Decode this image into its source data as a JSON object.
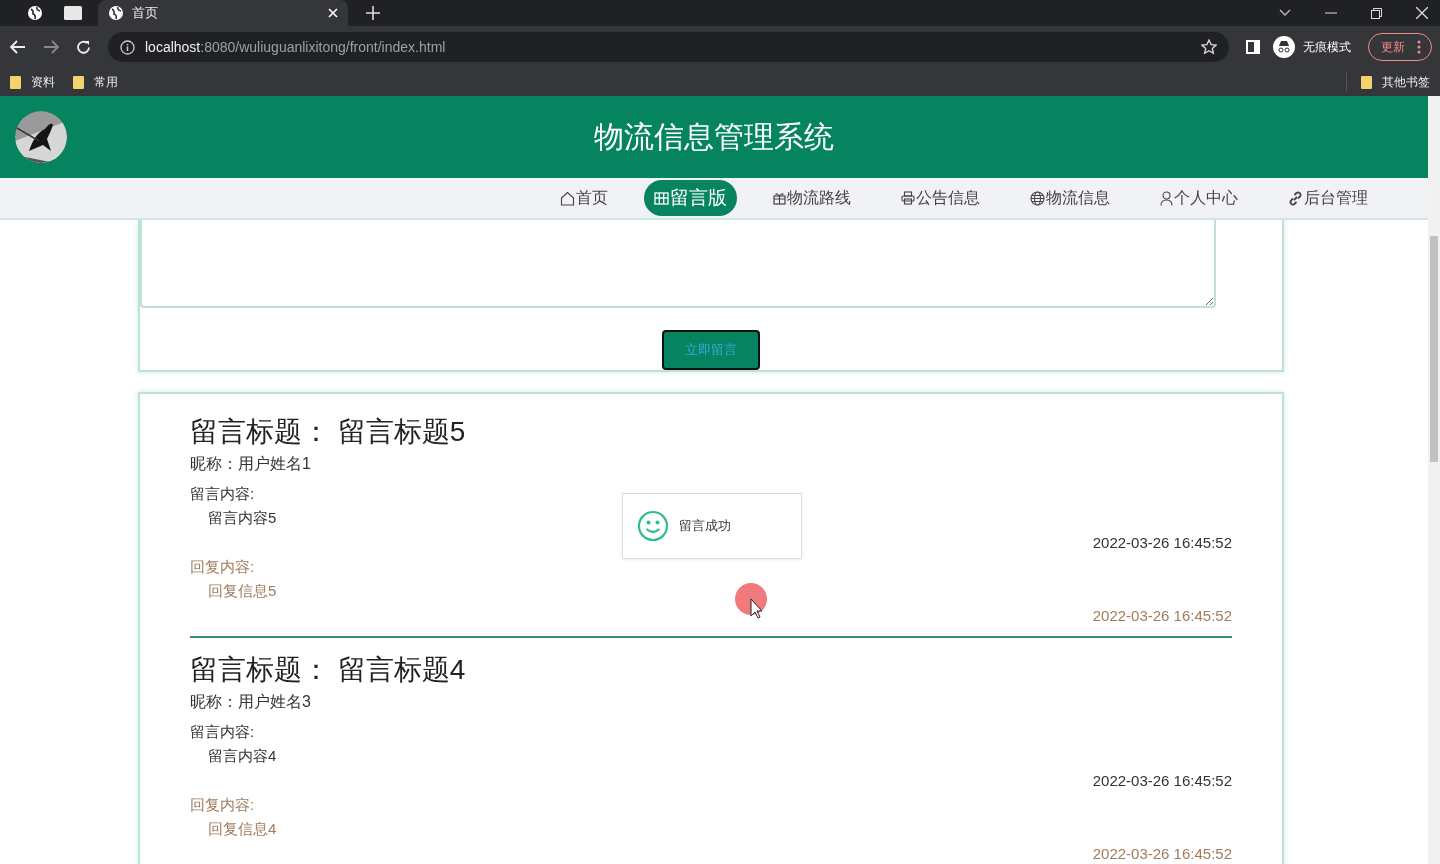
{
  "browser": {
    "tabs": [
      {
        "title": "首页",
        "selected": true
      }
    ],
    "address": {
      "host": "localhost",
      "path": ":8080/wuliuguanlixitong/front/index.html"
    },
    "profile": "无痕模式",
    "update_button": "更新",
    "bookmarks": [
      "资料",
      "常用"
    ],
    "other_bookmarks": "其他书签"
  },
  "header": {
    "title": "物流信息管理系统"
  },
  "nav": [
    {
      "label": "首页",
      "selected": false
    },
    {
      "label": "留言版",
      "selected": true
    },
    {
      "label": "物流路线",
      "selected": false
    },
    {
      "label": "公告信息",
      "selected": false
    },
    {
      "label": "物流信息",
      "selected": false
    },
    {
      "label": "个人中心",
      "selected": false
    },
    {
      "label": "后台管理",
      "selected": false
    }
  ],
  "form": {
    "submit_button": "立即留言"
  },
  "messages": [
    {
      "title_label": "留言标题：",
      "title": "留言标题5",
      "nickname": "昵称：用户姓名1",
      "content_label": "留言内容:",
      "content": "留言内容5",
      "time": "2022-03-26 16:45:52",
      "reply_label": "回复内容:",
      "reply": "回复信息5",
      "reply_time": "2022-03-26 16:45:52"
    },
    {
      "title_label": "留言标题：",
      "title": "留言标题4",
      "nickname": "昵称：用户姓名3",
      "content_label": "留言内容:",
      "content": "留言内容4",
      "time": "2022-03-26 16:45:52",
      "reply_label": "回复内容:",
      "reply": "回复信息4",
      "reply_time": "2022-03-26 16:45:52"
    }
  ],
  "toast": {
    "text": "留言成功"
  }
}
